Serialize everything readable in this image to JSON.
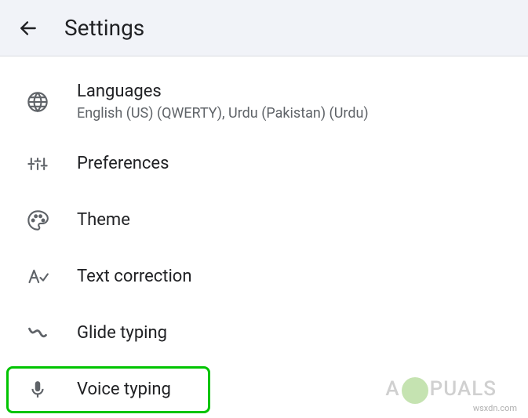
{
  "header": {
    "title": "Settings"
  },
  "items": [
    {
      "icon": "globe",
      "title": "Languages",
      "subtitle": "English (US) (QWERTY), Urdu (Pakistan) (Urdu)"
    },
    {
      "icon": "sliders",
      "title": "Preferences",
      "subtitle": ""
    },
    {
      "icon": "palette",
      "title": "Theme",
      "subtitle": ""
    },
    {
      "icon": "text-correction",
      "title": "Text correction",
      "subtitle": ""
    },
    {
      "icon": "glide",
      "title": "Glide typing",
      "subtitle": ""
    },
    {
      "icon": "mic",
      "title": "Voice typing",
      "subtitle": ""
    }
  ],
  "highlight_index": 5,
  "watermark": "wsxdn.com",
  "brand_prefix": "A",
  "brand_suffix": "PUALS"
}
